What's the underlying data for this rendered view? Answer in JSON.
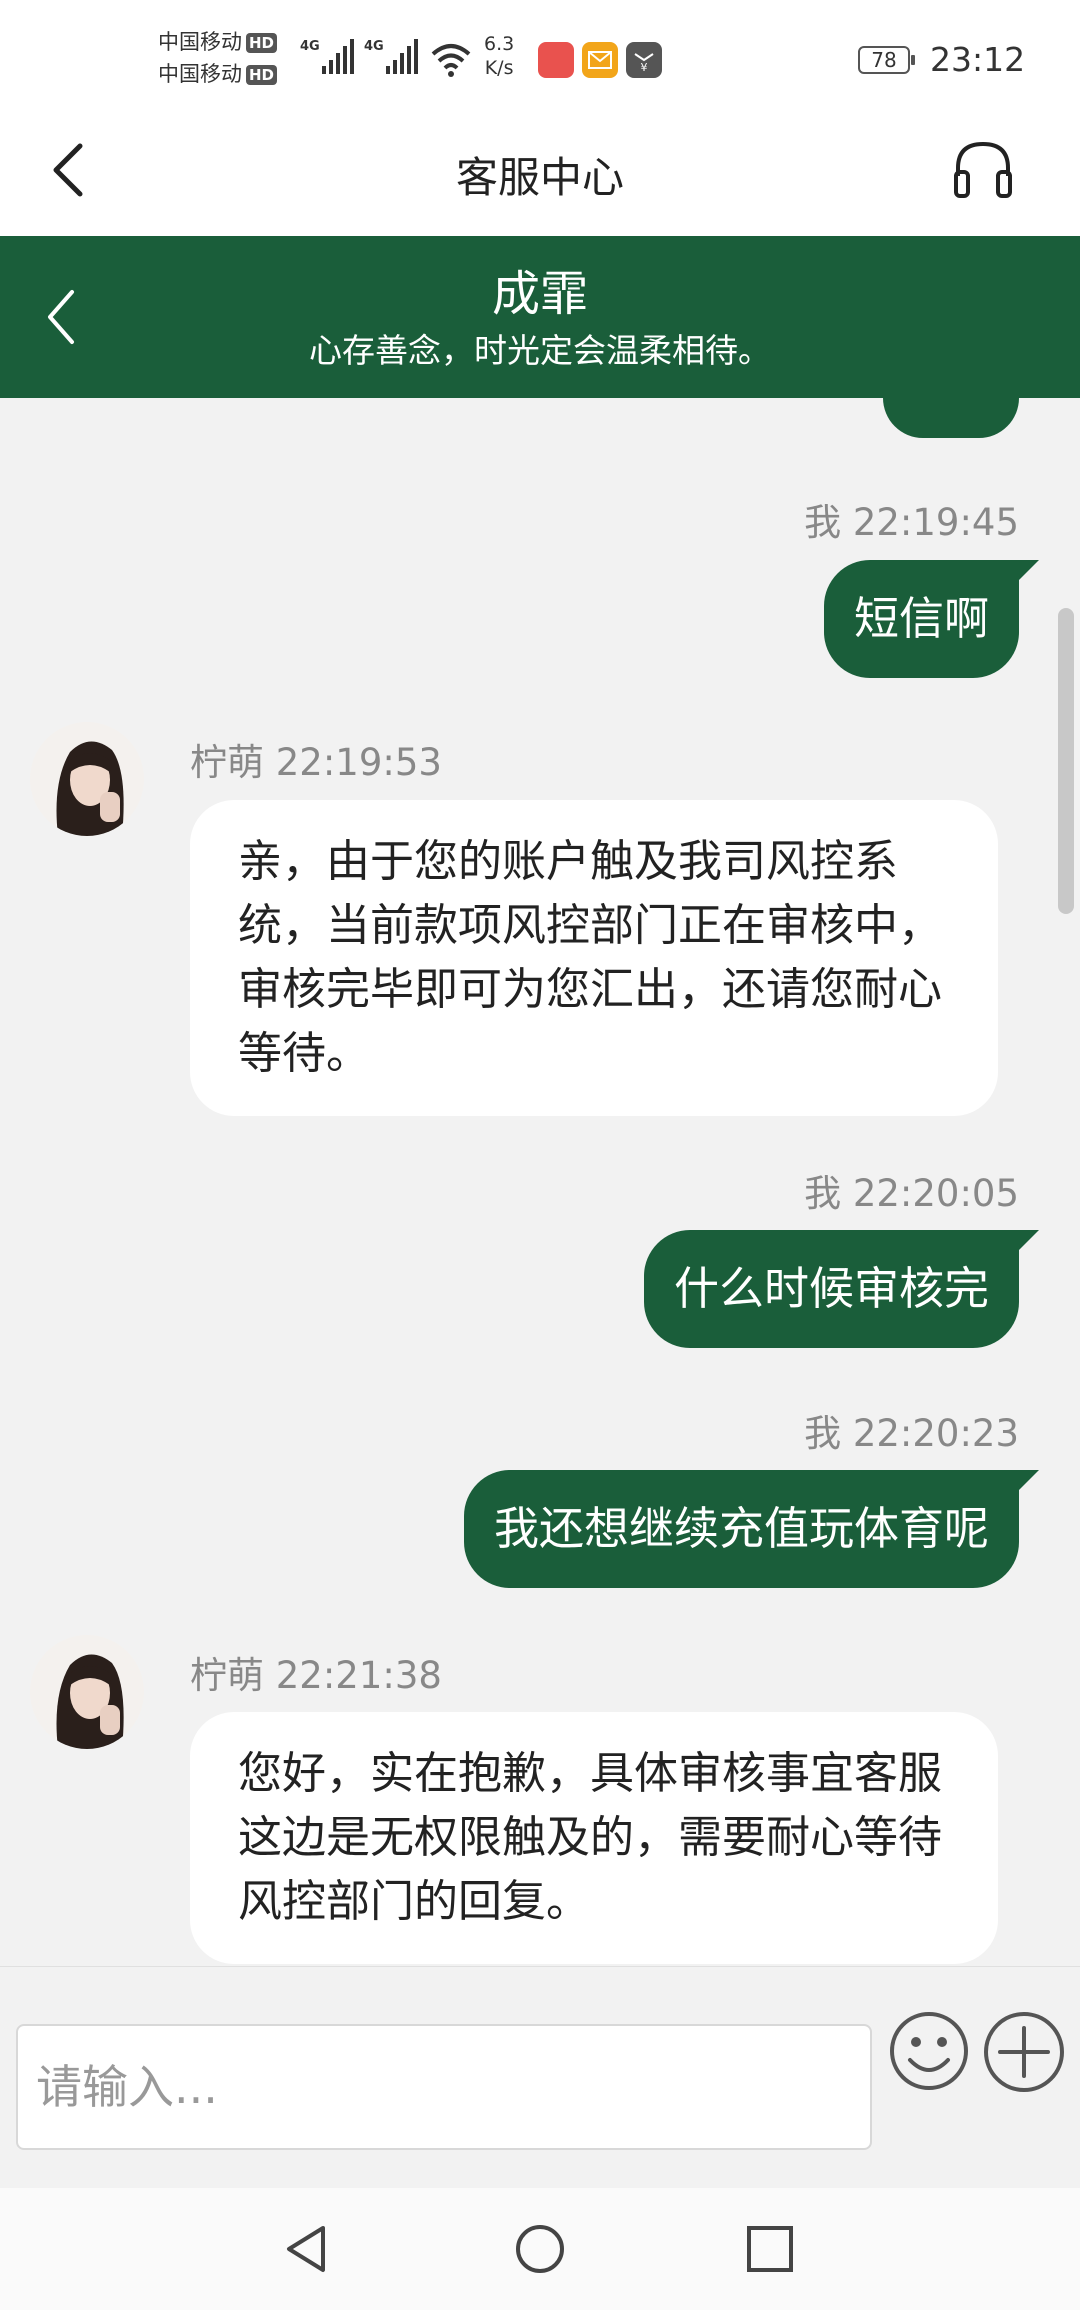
{
  "status_bar": {
    "carrier_1": "中国移动",
    "carrier_2": "中国移动",
    "hd_badge": "HD",
    "network_1": "4G",
    "network_2": "4G",
    "speed_value": "6.3",
    "speed_unit": "K/s",
    "battery": "78",
    "time": "23:12"
  },
  "header": {
    "title": "客服中心"
  },
  "contact": {
    "name": "成霏",
    "motto": "心存善念，时光定会温柔相待。"
  },
  "messages": [
    {
      "side": "out",
      "sender": "我",
      "time": "22:19:45",
      "sender_time": "我 22:19:45",
      "text": "短信啊"
    },
    {
      "side": "in",
      "sender": "柠萌",
      "time": "22:19:53",
      "sender_time": "柠萌 22:19:53",
      "text": "亲，由于您的账户触及我司风控系统，当前款项风控部门正在审核中，审核完毕即可为您汇出，还请您耐心等待。"
    },
    {
      "side": "out",
      "sender": "我",
      "time": "22:20:05",
      "sender_time": "我 22:20:05",
      "text": "什么时候审核完"
    },
    {
      "side": "out",
      "sender": "我",
      "time": "22:20:23",
      "sender_time": "我 22:20:23",
      "text": "我还想继续充值玩体育呢"
    },
    {
      "side": "in",
      "sender": "柠萌",
      "time": "22:21:38",
      "sender_time": "柠萌 22:21:38",
      "text": "您好，实在抱歉，具体审核事宜客服这边是无权限触及的，需要耐心等待风控部门的回复。"
    }
  ],
  "input": {
    "placeholder": "请输入..."
  },
  "colors": {
    "brand_green": "#1a5e3a",
    "background": "#f2f2f2",
    "bubble_in": "#ffffff"
  },
  "icons": [
    "back-icon",
    "headset-icon",
    "chevron-left-icon",
    "emoji-icon",
    "plus-icon",
    "nav-back-icon",
    "nav-home-icon",
    "nav-recents-icon"
  ]
}
